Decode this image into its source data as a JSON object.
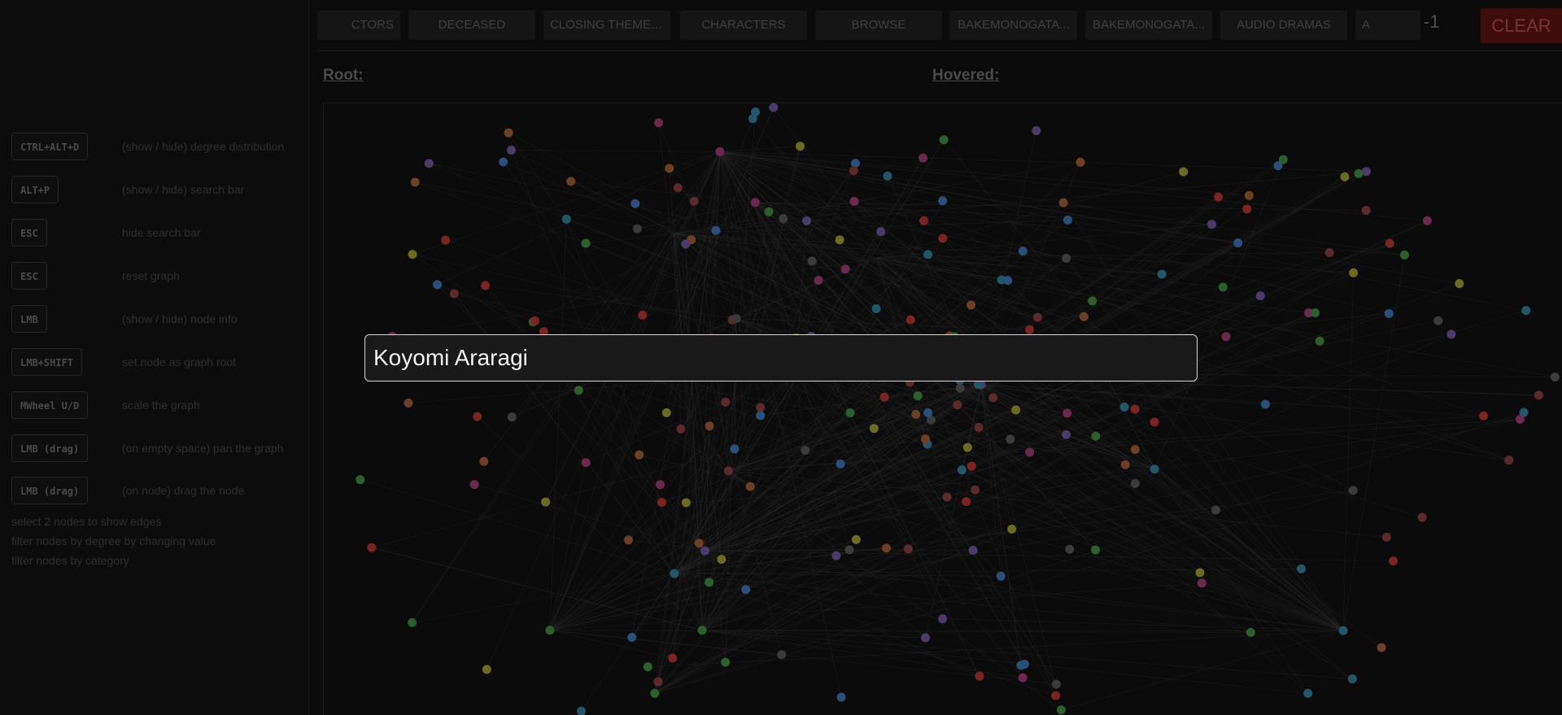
{
  "shortcuts": [
    {
      "key": "CTRL+ALT+D",
      "desc": "(show / hide) degree distribution"
    },
    {
      "key": "ALT+P",
      "desc": "(show / hide) search bar"
    },
    {
      "key": "ESC",
      "desc": "hide search bar"
    },
    {
      "key": "ESC",
      "desc": "reset graph"
    },
    {
      "key": "LMB",
      "desc": "(show / hide) node info"
    },
    {
      "key": "LMB+SHIFT",
      "desc": "set node as graph root"
    },
    {
      "key": "MWheel U/D",
      "desc": "scale the graph"
    },
    {
      "key": "LMB (drag)",
      "desc": "(on empty space) pan the graph"
    },
    {
      "key": "LMB (drag)",
      "desc": "(on node) drag the node"
    }
  ],
  "hints": [
    "select 2 nodes to show edges",
    "filter nodes by degree by changing value",
    "filter nodes by category"
  ],
  "categories": [
    "CTORS",
    "DECEASED",
    "CLOSING THEME ...",
    "CHARACTERS",
    "BROWSE",
    "BAKEMONOGATA...",
    "BAKEMONOGATA...",
    "AUDIO DRAMAS",
    "A"
  ],
  "degree_value": "-1",
  "clear_label": "CLEAR",
  "root_label": "Root:",
  "hovered_label": "Hovered:",
  "search": {
    "value": "Koyomi Araragi"
  },
  "node_colors": [
    "#2c4f7a",
    "#2b5f2b",
    "#6d3f26",
    "#3b3b3b",
    "#4b3b6b",
    "#6b2a4d",
    "#6b6b24",
    "#7a2424",
    "#24566a",
    "#5c2a2a"
  ]
}
